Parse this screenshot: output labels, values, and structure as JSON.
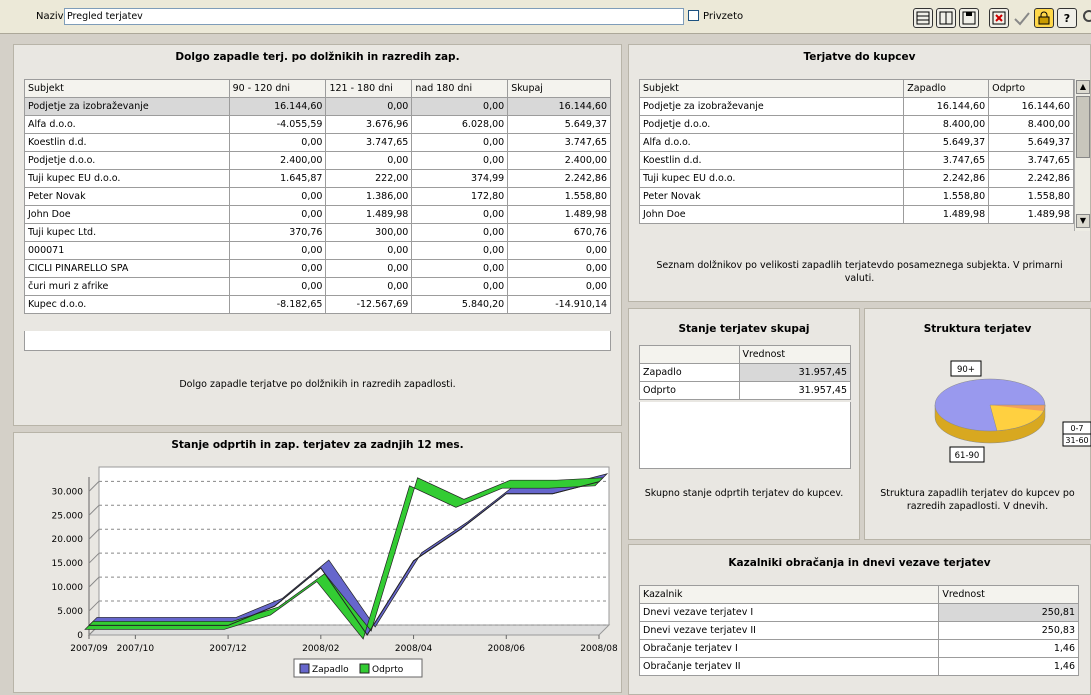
{
  "toolbar": {
    "name_label": "Naziv",
    "name_value": "Pregled terjatev",
    "checkbox_label": "Privzeto",
    "help_label": "?"
  },
  "aging": {
    "title": "Dolgo zapadle terj. po dolžnikih in razredih zap.",
    "columns": [
      "Subjekt",
      "90 - 120 dni",
      "121 - 180 dni",
      "nad 180 dni",
      "Skupaj"
    ],
    "rows": [
      [
        "Podjetje za izobraževanje",
        "16.144,60",
        "0,00",
        "0,00",
        "16.144,60"
      ],
      [
        "Alfa d.o.o.",
        "-4.055,59",
        "3.676,96",
        "6.028,00",
        "5.649,37"
      ],
      [
        "Koestlin d.d.",
        "0,00",
        "3.747,65",
        "0,00",
        "3.747,65"
      ],
      [
        "Podjetje d.o.o.",
        "2.400,00",
        "0,00",
        "0,00",
        "2.400,00"
      ],
      [
        "Tuji kupec EU d.o.o.",
        "1.645,87",
        "222,00",
        "374,99",
        "2.242,86"
      ],
      [
        "Peter Novak",
        "0,00",
        "1.386,00",
        "172,80",
        "1.558,80"
      ],
      [
        "John Doe",
        "0,00",
        "1.489,98",
        "0,00",
        "1.489,98"
      ],
      [
        "Tuji kupec Ltd.",
        "370,76",
        "300,00",
        "0,00",
        "670,76"
      ],
      [
        "000071",
        "0,00",
        "0,00",
        "0,00",
        "0,00"
      ],
      [
        "CICLI PINARELLO SPA",
        "0,00",
        "0,00",
        "0,00",
        "0,00"
      ],
      [
        "čuri muri z afrike",
        "0,00",
        "0,00",
        "0,00",
        "0,00"
      ],
      [
        "Kupec d.o.o.",
        "-8.182,65",
        "-12.567,69",
        "5.840,20",
        "-14.910,14"
      ]
    ],
    "description": "Dolgo zapadle terjatve po dolžnikih in razredih zapadlosti."
  },
  "customers": {
    "title": "Terjatve do kupcev",
    "columns": [
      "Subjekt",
      "Zapadlo",
      "Odprto"
    ],
    "rows": [
      [
        "Podjetje za izobraževanje",
        "16.144,60",
        "16.144,60"
      ],
      [
        "Podjetje d.o.o.",
        "8.400,00",
        "8.400,00"
      ],
      [
        "Alfa d.o.o.",
        "5.649,37",
        "5.649,37"
      ],
      [
        "Koestlin d.d.",
        "3.747,65",
        "3.747,65"
      ],
      [
        "Tuji kupec EU d.o.o.",
        "2.242,86",
        "2.242,86"
      ],
      [
        "Peter Novak",
        "1.558,80",
        "1.558,80"
      ],
      [
        "John Doe",
        "1.489,98",
        "1.489,98"
      ]
    ],
    "description": "Seznam dolžnikov po velikosti zapadlih terjatevdo posameznega subjekta. V primarni valuti."
  },
  "totals": {
    "title": "Stanje terjatev skupaj",
    "header": "Vrednost",
    "rows": [
      [
        "Zapadlo",
        "31.957,45"
      ],
      [
        "Odprto",
        "31.957,45"
      ]
    ],
    "description": "Skupno stanje odprtih terjatev do kupcev."
  },
  "structure": {
    "title": "Struktura terjatev",
    "labels": [
      "90+",
      "0-7",
      "31-60",
      "61-90"
    ],
    "colors": [
      "#9999ee",
      "#f0a060",
      "#f0a060",
      "#ffd040"
    ],
    "description": "Struktura zapadlih terjatev do kupcev po razredih zapadlosti. V dnevih."
  },
  "ratios": {
    "title": "Kazalniki obračanja in dnevi vezave terjatev",
    "columns": [
      "Kazalnik",
      "Vrednost"
    ],
    "rows": [
      [
        "Dnevi vezave terjatev I",
        "250,81"
      ],
      [
        "Dnevi vezave terjatev II",
        "250,83"
      ],
      [
        "Obračanje terjatev I",
        "1,46"
      ],
      [
        "Obračanje terjatev II",
        "1,46"
      ]
    ]
  },
  "chart_data": {
    "type": "line",
    "title": "Stanje odprtih in zap. terjatev za zadnjih 12 mes.",
    "x_tick_labels": [
      "2007/09",
      "2007/10",
      "2007/12",
      "2008/02",
      "2008/04",
      "2008/06",
      "2008/08"
    ],
    "y_tick_labels": [
      "0",
      "5.000",
      "10.000",
      "15.000",
      "20.000",
      "25.000",
      "30.000"
    ],
    "ylim": [
      0,
      30000
    ],
    "series": [
      {
        "name": "Zapadlo",
        "color": "#6666cc",
        "values": [
          2000,
          2000,
          2000,
          2000,
          6000,
          14000,
          0,
          15500,
          22000,
          29500,
          29500,
          32000
        ]
      },
      {
        "name": "Odprto",
        "color": "#33cc33",
        "values": [
          2000,
          2000,
          2000,
          2000,
          5000,
          12000,
          0,
          32000,
          27500,
          31500,
          31500,
          32000
        ]
      }
    ]
  }
}
